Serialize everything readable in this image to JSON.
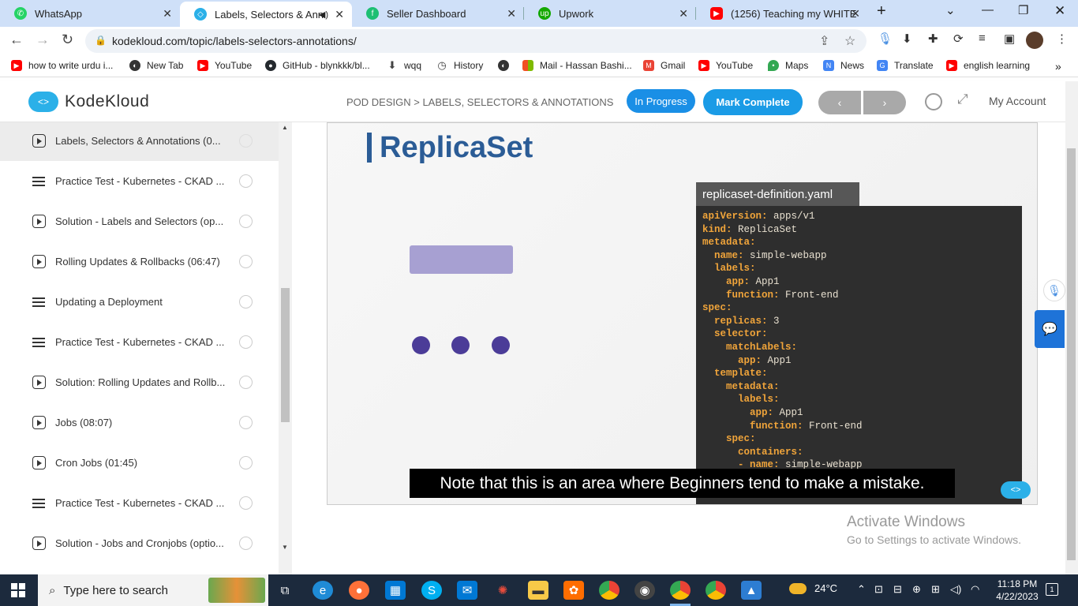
{
  "browser": {
    "tabs": [
      {
        "title": "WhatsApp",
        "color": "#25d366",
        "icon": "whatsapp-icon"
      },
      {
        "title": "Labels, Selectors & Anno",
        "color": "#2bb0e8",
        "icon": "kodekloud-icon",
        "active": true
      },
      {
        "title": "Seller Dashboard",
        "color": "#1dbf73",
        "icon": "fiverr-icon"
      },
      {
        "title": "Upwork",
        "color": "#14a800",
        "icon": "upwork-icon"
      },
      {
        "title": "(1256) Teaching my WHITE fr",
        "color": "#ff0000",
        "icon": "youtube-icon"
      }
    ],
    "url": "kodekloud.com/topic/labels-selectors-annotations/",
    "bookmarks": [
      {
        "label": "how to write urdu i...",
        "color": "#ff0000",
        "icon": "youtube-icon"
      },
      {
        "label": "New Tab",
        "color": "#333333",
        "icon": "globe-icon"
      },
      {
        "label": "YouTube",
        "color": "#ff0000",
        "icon": "youtube-icon"
      },
      {
        "label": "GitHub - blynkkk/bl...",
        "color": "#24292e",
        "icon": "github-icon"
      },
      {
        "label": "wqq",
        "color": "#444444",
        "icon": "download-icon"
      },
      {
        "label": "History",
        "color": "#444444",
        "icon": "history-icon"
      },
      {
        "label": "",
        "color": "#333333",
        "icon": "globe-icon"
      },
      {
        "label": "Mail - Hassan Bashi...",
        "color": "#f25022",
        "icon": "microsoft-icon"
      },
      {
        "label": "Gmail",
        "color": "#ea4335",
        "icon": "gmail-icon"
      },
      {
        "label": "YouTube",
        "color": "#ff0000",
        "icon": "youtube-icon"
      },
      {
        "label": "Maps",
        "color": "#34a853",
        "icon": "maps-icon"
      },
      {
        "label": "News",
        "color": "#4285f4",
        "icon": "news-icon"
      },
      {
        "label": "Translate",
        "color": "#4285f4",
        "icon": "translate-icon"
      },
      {
        "label": "english learning",
        "color": "#ff0000",
        "icon": "youtube-icon"
      }
    ]
  },
  "header": {
    "logo": "KodeKloud",
    "breadcrumb": "POD DESIGN > LABELS, SELECTORS & ANNOTATIONS",
    "in_progress": "In Progress",
    "mark_complete": "Mark Complete",
    "prev": "‹",
    "next": "›",
    "account": "My Account",
    "accent": "#1a9be6"
  },
  "sidebar": {
    "items": [
      {
        "label": "Labels, Selectors & Annotations (0...",
        "type": "video",
        "current": true
      },
      {
        "label": "Practice Test - Kubernetes - CKAD ...",
        "type": "lab"
      },
      {
        "label": "Solution - Labels and Selectors (op...",
        "type": "video"
      },
      {
        "label": "Rolling Updates & Rollbacks (06:47)",
        "type": "video"
      },
      {
        "label": "Updating a Deployment",
        "type": "lab"
      },
      {
        "label": "Practice Test - Kubernetes - CKAD ...",
        "type": "lab"
      },
      {
        "label": "Solution: Rolling Updates and Rollb...",
        "type": "video"
      },
      {
        "label": "Jobs (08:07)",
        "type": "video"
      },
      {
        "label": "Cron Jobs (01:45)",
        "type": "video"
      },
      {
        "label": "Practice Test - Kubernetes - CKAD ...",
        "type": "lab"
      },
      {
        "label": "Solution - Jobs and Cronjobs (optio...",
        "type": "video"
      }
    ]
  },
  "video": {
    "slide_title": "ReplicaSet",
    "yaml_filename": "replicaset-definition.yaml",
    "yaml_lines": [
      {
        "key": "apiVersion:",
        "value": " apps/v1",
        "indent": 0
      },
      {
        "key": "kind:",
        "value": " ReplicaSet",
        "indent": 0
      },
      {
        "key": "metadata:",
        "value": "",
        "indent": 0
      },
      {
        "key": "name:",
        "value": " simple-webapp",
        "indent": 1
      },
      {
        "key": "labels:",
        "value": "",
        "indent": 1
      },
      {
        "key": "app:",
        "value": " App1",
        "indent": 2
      },
      {
        "key": "function:",
        "value": " Front-end",
        "indent": 2
      },
      {
        "key": "spec:",
        "value": "",
        "indent": 0
      },
      {
        "key": "replicas:",
        "value": " 3",
        "indent": 1
      },
      {
        "key": "selector:",
        "value": "",
        "indent": 1
      },
      {
        "key": "matchLabels:",
        "value": "",
        "indent": 2
      },
      {
        "key": "app:",
        "value": " App1",
        "indent": 3
      },
      {
        "key": "template:",
        "value": "",
        "indent": 1
      },
      {
        "key": "metadata:",
        "value": "",
        "indent": 2
      },
      {
        "key": "labels:",
        "value": "",
        "indent": 3
      },
      {
        "key": "app:",
        "value": " App1",
        "indent": 4
      },
      {
        "key": "function:",
        "value": " Front-end",
        "indent": 4
      },
      {
        "key": "spec:",
        "value": "",
        "indent": 2
      },
      {
        "key": "containers:",
        "value": "",
        "indent": 3
      },
      {
        "key": "- name:",
        "value": " simple-webapp",
        "indent": 3
      }
    ],
    "caption": "Note that this is an area where Beginners tend to make a mistake."
  },
  "watermark": {
    "line1": "Activate Windows",
    "line2": "Go to Settings to activate Windows."
  },
  "taskbar": {
    "search_placeholder": "Type here to search",
    "weather": "24°C",
    "time": "11:18 PM",
    "date": "4/22/2023"
  }
}
